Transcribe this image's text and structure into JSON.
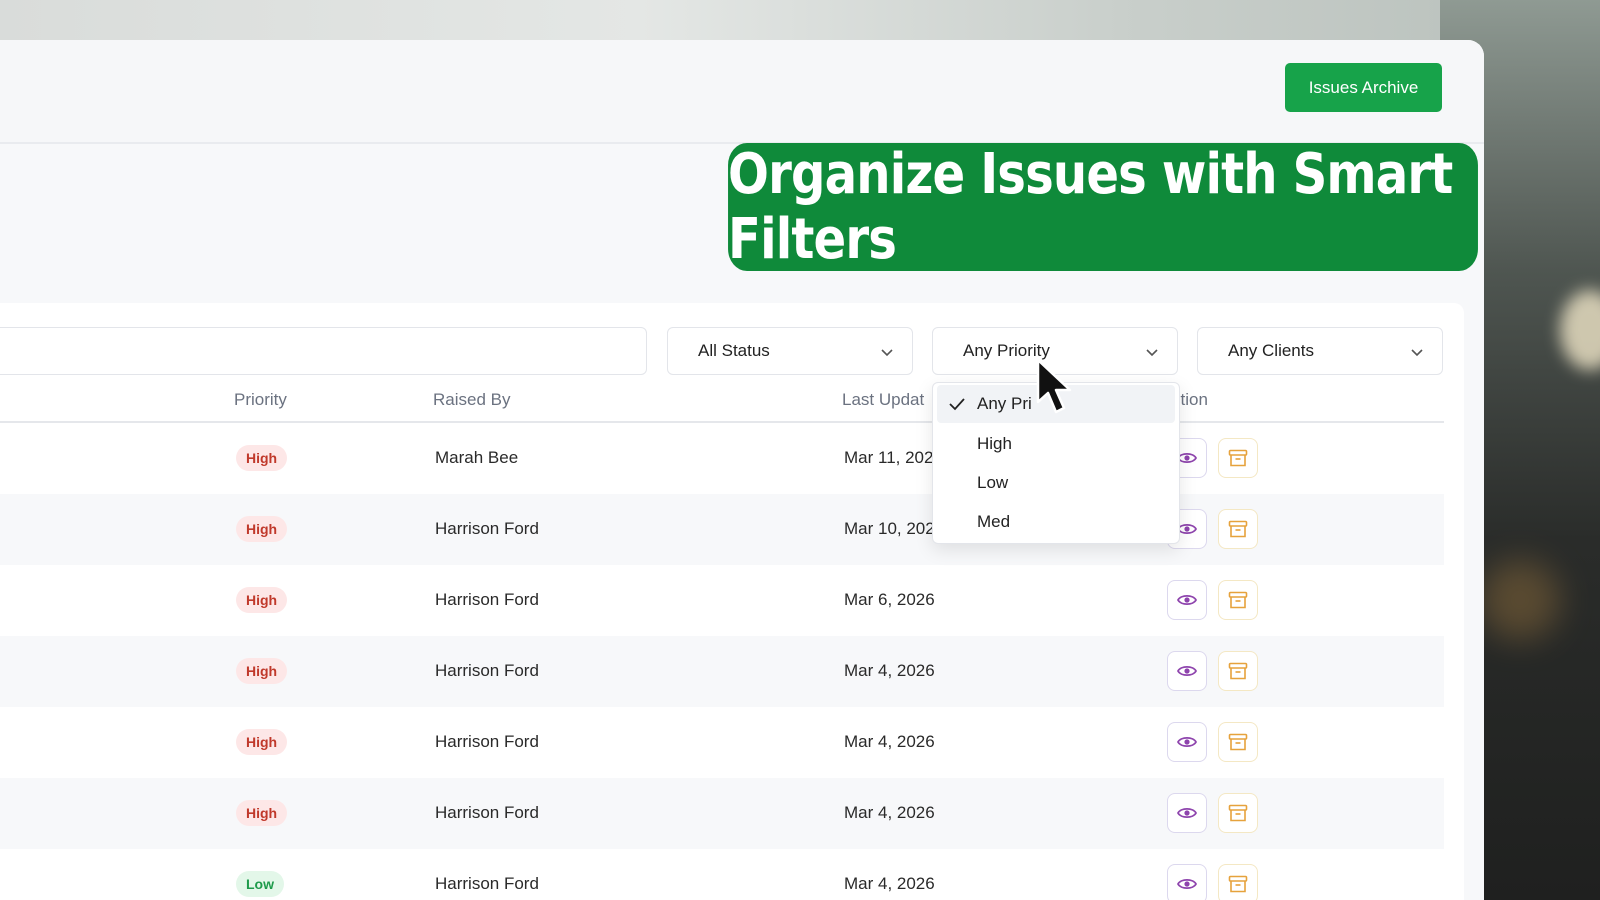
{
  "header": {
    "archive_button": "Issues Archive"
  },
  "banner": {
    "text": "Organize Issues with Smart Filters"
  },
  "filters": {
    "status": "All Status",
    "priority": "Any Priority",
    "clients": "Any Clients"
  },
  "priority_menu": {
    "options": [
      "Any Priority",
      "High",
      "Low",
      "Med"
    ],
    "selected_index": 0,
    "visible_option_0": "Any Pri"
  },
  "table": {
    "headers": {
      "priority": "Priority",
      "raised_by": "Raised By",
      "last_updated": "Last Updat",
      "action": "ction"
    },
    "rows": [
      {
        "priority": "High",
        "raised_by": "Marah Bee",
        "last_updated": "Mar 11, 202"
      },
      {
        "priority": "High",
        "raised_by": "Harrison Ford",
        "last_updated": "Mar 10, 202"
      },
      {
        "priority": "High",
        "raised_by": "Harrison Ford",
        "last_updated": "Mar 6, 2026"
      },
      {
        "priority": "High",
        "raised_by": "Harrison Ford",
        "last_updated": "Mar 4, 2026"
      },
      {
        "priority": "High",
        "raised_by": "Harrison Ford",
        "last_updated": "Mar 4, 2026"
      },
      {
        "priority": "High",
        "raised_by": "Harrison Ford",
        "last_updated": "Mar 4, 2026"
      },
      {
        "priority": "Low",
        "raised_by": "Harrison Ford",
        "last_updated": "Mar 4, 2026"
      }
    ]
  },
  "colors": {
    "accent_green": "#17a34a",
    "banner_green": "#0f8a3a",
    "high_badge": "#c0392b",
    "low_badge": "#1e9b4b",
    "view_icon": "#8e44ad",
    "archive_icon": "#e6a23c"
  },
  "icons": {
    "view": "eye-icon",
    "archive": "archive-box-icon",
    "dropdown": "chevron-down-icon",
    "selected": "check-icon",
    "pointer": "cursor-icon"
  }
}
